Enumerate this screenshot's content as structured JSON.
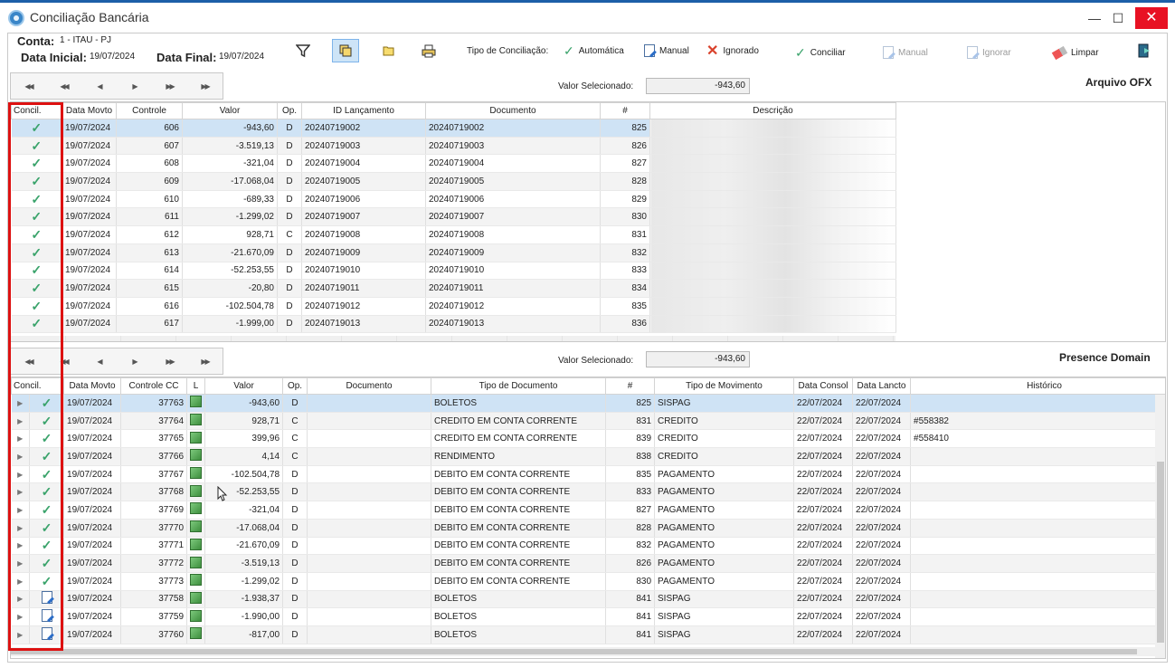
{
  "window": {
    "title": "Conciliação Bancária",
    "min": "—",
    "max": "☐",
    "close": "✕"
  },
  "header": {
    "conta_label": "Conta:",
    "conta_value": "1 - ITAU - PJ",
    "data_inicial_label": "Data Inicial:",
    "data_inicial_value": "19/07/2024",
    "data_final_label": "Data Final:",
    "data_final_value": "19/07/2024"
  },
  "toolbar": {
    "tipo_label": "Tipo de Conciliação:",
    "automatica": "Automática",
    "manual": "Manual",
    "ignorado": "Ignorado",
    "conciliar": "Conciliar",
    "manual_action": "Manual",
    "ignorar": "Ignorar",
    "limpar": "Limpar"
  },
  "ofx": {
    "title": "Arquivo OFX",
    "valor_selecionado_label": "Valor Selecionado:",
    "valor_selecionado": "-943,60",
    "columns": [
      "Concil.",
      "Data Movto",
      "Controle",
      "Valor",
      "Op.",
      "ID Lançamento",
      "Documento",
      "#",
      "Descrição"
    ],
    "rows": [
      [
        "19/07/2024",
        "606",
        "-943,60",
        "D",
        "20240719002",
        "20240719002",
        "825"
      ],
      [
        "19/07/2024",
        "607",
        "-3.519,13",
        "D",
        "20240719003",
        "20240719003",
        "826"
      ],
      [
        "19/07/2024",
        "608",
        "-321,04",
        "D",
        "20240719004",
        "20240719004",
        "827"
      ],
      [
        "19/07/2024",
        "609",
        "-17.068,04",
        "D",
        "20240719005",
        "20240719005",
        "828"
      ],
      [
        "19/07/2024",
        "610",
        "-689,33",
        "D",
        "20240719006",
        "20240719006",
        "829"
      ],
      [
        "19/07/2024",
        "611",
        "-1.299,02",
        "D",
        "20240719007",
        "20240719007",
        "830"
      ],
      [
        "19/07/2024",
        "612",
        "928,71",
        "C",
        "20240719008",
        "20240719008",
        "831"
      ],
      [
        "19/07/2024",
        "613",
        "-21.670,09",
        "D",
        "20240719009",
        "20240719009",
        "832"
      ],
      [
        "19/07/2024",
        "614",
        "-52.253,55",
        "D",
        "20240719010",
        "20240719010",
        "833"
      ],
      [
        "19/07/2024",
        "615",
        "-20,80",
        "D",
        "20240719011",
        "20240719011",
        "834"
      ],
      [
        "19/07/2024",
        "616",
        "-102.504,78",
        "D",
        "20240719012",
        "20240719012",
        "835"
      ],
      [
        "19/07/2024",
        "617",
        "-1.999,00",
        "D",
        "20240719013",
        "20240719013",
        "836"
      ]
    ]
  },
  "presence": {
    "title": "Presence Domain",
    "valor_selecionado_label": "Valor Selecionado:",
    "valor_selecionado": "-943,60",
    "columns": [
      "Concil.",
      "Data Movto",
      "Controle CC",
      "L",
      "Valor",
      "Op.",
      "Documento",
      "Tipo de Documento",
      "#",
      "Tipo de Movimento",
      "Data Consol",
      "Data Lancto",
      "Histórico"
    ],
    "rows": [
      [
        "check",
        "19/07/2024",
        "37763",
        "-943,60",
        "D",
        "",
        "BOLETOS",
        "825",
        "SISPAG",
        "22/07/2024",
        "22/07/2024",
        ""
      ],
      [
        "check",
        "19/07/2024",
        "37764",
        "928,71",
        "C",
        "",
        "CREDITO EM CONTA CORRENTE",
        "831",
        "CREDITO",
        "22/07/2024",
        "22/07/2024",
        "#558382"
      ],
      [
        "check",
        "19/07/2024",
        "37765",
        "399,96",
        "C",
        "",
        "CREDITO EM CONTA CORRENTE",
        "839",
        "CREDITO",
        "22/07/2024",
        "22/07/2024",
        "#558410"
      ],
      [
        "check",
        "19/07/2024",
        "37766",
        "4,14",
        "C",
        "",
        "RENDIMENTO",
        "838",
        "CREDITO",
        "22/07/2024",
        "22/07/2024",
        ""
      ],
      [
        "check",
        "19/07/2024",
        "37767",
        "-102.504,78",
        "D",
        "",
        "DEBITO EM CONTA CORRENTE",
        "835",
        "PAGAMENTO",
        "22/07/2024",
        "22/07/2024",
        ""
      ],
      [
        "check",
        "19/07/2024",
        "37768",
        "-52.253,55",
        "D",
        "",
        "DEBITO EM CONTA CORRENTE",
        "833",
        "PAGAMENTO",
        "22/07/2024",
        "22/07/2024",
        ""
      ],
      [
        "check",
        "19/07/2024",
        "37769",
        "-321,04",
        "D",
        "",
        "DEBITO EM CONTA CORRENTE",
        "827",
        "PAGAMENTO",
        "22/07/2024",
        "22/07/2024",
        ""
      ],
      [
        "check",
        "19/07/2024",
        "37770",
        "-17.068,04",
        "D",
        "",
        "DEBITO EM CONTA CORRENTE",
        "828",
        "PAGAMENTO",
        "22/07/2024",
        "22/07/2024",
        ""
      ],
      [
        "check",
        "19/07/2024",
        "37771",
        "-21.670,09",
        "D",
        "",
        "DEBITO EM CONTA CORRENTE",
        "832",
        "PAGAMENTO",
        "22/07/2024",
        "22/07/2024",
        ""
      ],
      [
        "check",
        "19/07/2024",
        "37772",
        "-3.519,13",
        "D",
        "",
        "DEBITO EM CONTA CORRENTE",
        "826",
        "PAGAMENTO",
        "22/07/2024",
        "22/07/2024",
        ""
      ],
      [
        "check",
        "19/07/2024",
        "37773",
        "-1.299,02",
        "D",
        "",
        "DEBITO EM CONTA CORRENTE",
        "830",
        "PAGAMENTO",
        "22/07/2024",
        "22/07/2024",
        ""
      ],
      [
        "edit",
        "19/07/2024",
        "37758",
        "-1.938,37",
        "D",
        "",
        "BOLETOS",
        "841",
        "SISPAG",
        "22/07/2024",
        "22/07/2024",
        ""
      ],
      [
        "edit",
        "19/07/2024",
        "37759",
        "-1.990,00",
        "D",
        "",
        "BOLETOS",
        "841",
        "SISPAG",
        "22/07/2024",
        "22/07/2024",
        ""
      ],
      [
        "edit",
        "19/07/2024",
        "37760",
        "-817,00",
        "D",
        "",
        "BOLETOS",
        "841",
        "SISPAG",
        "22/07/2024",
        "22/07/2024",
        ""
      ]
    ]
  },
  "colors": {
    "accent": "#1d5fa8",
    "check": "#3aa36b",
    "selection": "#cfe3f5",
    "highlight": "#dd1111"
  }
}
